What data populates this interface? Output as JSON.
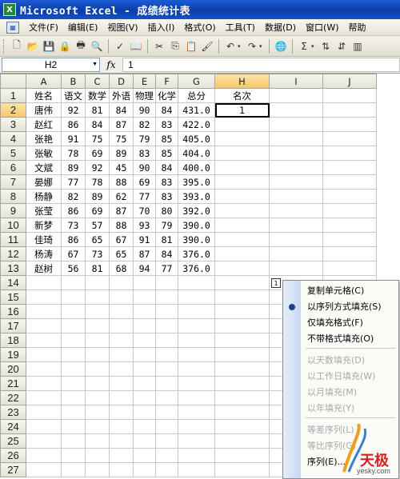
{
  "window": {
    "app_icon": "X",
    "title": "Microsoft Excel - 成绩统计表"
  },
  "menubar": {
    "items": [
      "文件(F)",
      "编辑(E)",
      "视图(V)",
      "插入(I)",
      "格式(O)",
      "工具(T)",
      "数据(D)",
      "窗口(W)",
      "帮助"
    ]
  },
  "toolbar": {
    "icons": [
      "new-icon",
      "open-icon",
      "save-icon",
      "permission-icon",
      "print-icon",
      "print-preview-icon",
      "spelling-icon",
      "research-icon",
      "cut-icon",
      "copy-icon",
      "paste-icon",
      "format-painter-icon",
      "undo-icon",
      "redo-icon",
      "hyperlink-icon",
      "autosum-icon",
      "sort-asc-icon",
      "sort-desc-icon",
      "chart-icon"
    ],
    "glyphs": {
      "new-icon": "🗋",
      "open-icon": "📂",
      "save-icon": "💾",
      "permission-icon": "🔒",
      "print-icon": "🖶",
      "print-preview-icon": "🔍",
      "spelling-icon": "✓",
      "research-icon": "📖",
      "cut-icon": "✂",
      "copy-icon": "⎘",
      "paste-icon": "📋",
      "format-painter-icon": "🖌",
      "undo-icon": "↶",
      "redo-icon": "↷",
      "hyperlink-icon": "🌐",
      "autosum-icon": "Σ",
      "sort-asc-icon": "⇅",
      "sort-desc-icon": "⇵",
      "chart-icon": "▥"
    }
  },
  "formula_bar": {
    "name_box": "H2",
    "fx_label": "fx",
    "value": "1"
  },
  "sheet": {
    "columns": [
      "A",
      "B",
      "C",
      "D",
      "E",
      "F",
      "G",
      "H",
      "I",
      "J"
    ],
    "active_column": "H",
    "active_row": 2,
    "headers": [
      "姓名",
      "语文",
      "数学",
      "外语",
      "物理",
      "化学",
      "总分",
      "名次"
    ],
    "rows": [
      [
        "唐伟",
        "92",
        "81",
        "84",
        "90",
        "84",
        "431.0",
        "1"
      ],
      [
        "赵红",
        "86",
        "84",
        "87",
        "82",
        "83",
        "422.0",
        ""
      ],
      [
        "张艳",
        "91",
        "75",
        "75",
        "79",
        "85",
        "405.0",
        ""
      ],
      [
        "张敏",
        "78",
        "69",
        "89",
        "83",
        "85",
        "404.0",
        ""
      ],
      [
        "文斌",
        "89",
        "92",
        "45",
        "90",
        "84",
        "400.0",
        ""
      ],
      [
        "晏娜",
        "77",
        "78",
        "88",
        "69",
        "83",
        "395.0",
        ""
      ],
      [
        "杨静",
        "82",
        "89",
        "62",
        "77",
        "83",
        "393.0",
        ""
      ],
      [
        "张莹",
        "86",
        "69",
        "87",
        "70",
        "80",
        "392.0",
        ""
      ],
      [
        "新梦",
        "73",
        "57",
        "88",
        "93",
        "79",
        "390.0",
        ""
      ],
      [
        "佳琦",
        "86",
        "65",
        "67",
        "91",
        "81",
        "390.0",
        ""
      ],
      [
        "杨涛",
        "67",
        "73",
        "65",
        "87",
        "84",
        "376.0",
        ""
      ],
      [
        "赵树",
        "56",
        "81",
        "68",
        "94",
        "77",
        "376.0",
        ""
      ]
    ],
    "row_numbers": [
      "1",
      "2",
      "3",
      "4",
      "5",
      "6",
      "7",
      "8",
      "9",
      "10",
      "11",
      "12",
      "13",
      "14",
      "15",
      "16",
      "17",
      "18",
      "19",
      "20",
      "21",
      "22",
      "23",
      "24",
      "25",
      "26",
      "27"
    ]
  },
  "autofill_popup": {
    "tag_label": "1",
    "items": [
      {
        "label": "复制单元格(C)",
        "enabled": true
      },
      {
        "label": "以序列方式填充(S)",
        "enabled": true
      },
      {
        "label": "仅填充格式(F)",
        "enabled": true
      },
      {
        "label": "不带格式填充(O)",
        "enabled": true
      },
      {
        "label": "以天数填充(D)",
        "enabled": false
      },
      {
        "label": "以工作日填充(W)",
        "enabled": false
      },
      {
        "label": "以月填充(M)",
        "enabled": false
      },
      {
        "label": "以年填充(Y)",
        "enabled": false
      },
      {
        "label": "等差序列(L)",
        "enabled": false
      },
      {
        "label": "等比序列(G)",
        "enabled": false
      },
      {
        "label": "序列(E)...",
        "enabled": true
      }
    ]
  },
  "watermark": {
    "brand": "天极",
    "site": "yesky.com"
  }
}
